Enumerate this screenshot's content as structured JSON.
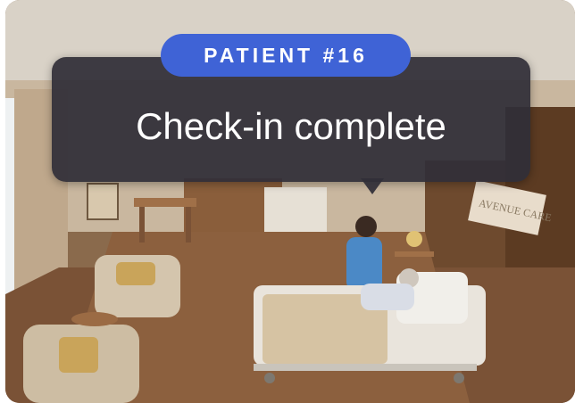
{
  "badge": {
    "label": "PATIENT #16"
  },
  "message": {
    "headline": "Check-in complete"
  },
  "scene": {
    "wall_sign": "AVENUE CARE"
  },
  "colors": {
    "badge_bg": "#3f63d6",
    "callout_bg": "#302e38",
    "text": "#ffffff"
  }
}
